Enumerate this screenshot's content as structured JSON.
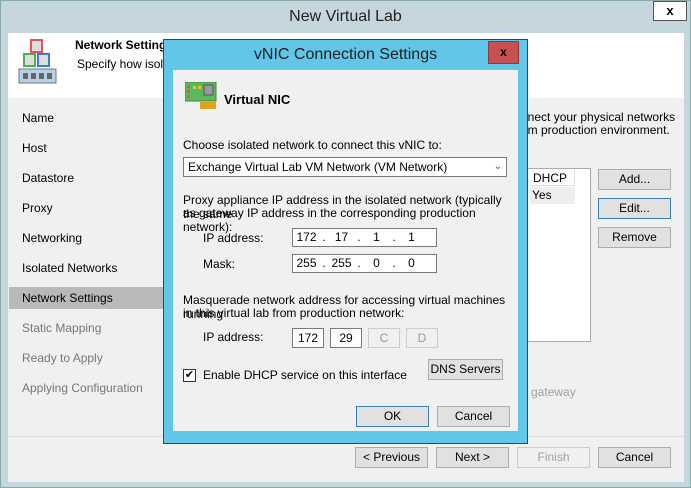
{
  "window": {
    "title": "New Virtual Lab",
    "close": "x"
  },
  "header": {
    "title": "Network Settings",
    "subtitle": "Specify how isolate"
  },
  "nav": [
    {
      "label": "Name",
      "enabled": true
    },
    {
      "label": "Host",
      "enabled": true
    },
    {
      "label": "Datastore",
      "enabled": true
    },
    {
      "label": "Proxy",
      "enabled": true
    },
    {
      "label": "Networking",
      "enabled": true
    },
    {
      "label": "Isolated Networks",
      "enabled": true
    },
    {
      "label": "Network Settings",
      "enabled": true,
      "selected": true
    },
    {
      "label": "Static Mapping",
      "enabled": false
    },
    {
      "label": "Ready to Apply",
      "enabled": false
    },
    {
      "label": "Applying Configuration",
      "enabled": false
    }
  ],
  "main": {
    "description_line1": "nnect your physical networks",
    "description_line2": "om production environment.",
    "table": {
      "columns": [
        "DHCP"
      ],
      "rows": [
        [
          "Yes"
        ]
      ]
    },
    "add": "Add...",
    "edit": "Edit...",
    "remove": "Remove",
    "gateway_text": "e gateway"
  },
  "footer": {
    "previous": "< Previous",
    "next": "Next >",
    "finish": "Finish",
    "cancel": "Cancel"
  },
  "dialog": {
    "title": "vNIC Connection Settings",
    "close": "x",
    "heading": "Virtual NIC",
    "network_label": "Choose isolated network to connect this vNIC to:",
    "network_value": "Exchange Virtual Lab VM Network (VM Network)",
    "proxy_label_1": "Proxy appliance IP address in the isolated network (typically the same",
    "proxy_label_2": "as gateway IP address in the corresponding production network):",
    "ip_label": "IP address:",
    "ip": [
      "172",
      "17",
      "1",
      "1"
    ],
    "mask_label": "Mask:",
    "mask": [
      "255",
      "255",
      "0",
      "0"
    ],
    "masq_label_1": "Masquerade network address for accessing virtual machines running",
    "masq_label_2": "in this virtual lab from production network:",
    "masq_ip_label": "IP address:",
    "masq_ip": [
      "172",
      "29",
      "C",
      "D"
    ],
    "dhcp_label": "Enable DHCP service on this interface",
    "dhcp_checked": true,
    "dns": "DNS Servers",
    "ok": "OK",
    "cancel": "Cancel"
  }
}
